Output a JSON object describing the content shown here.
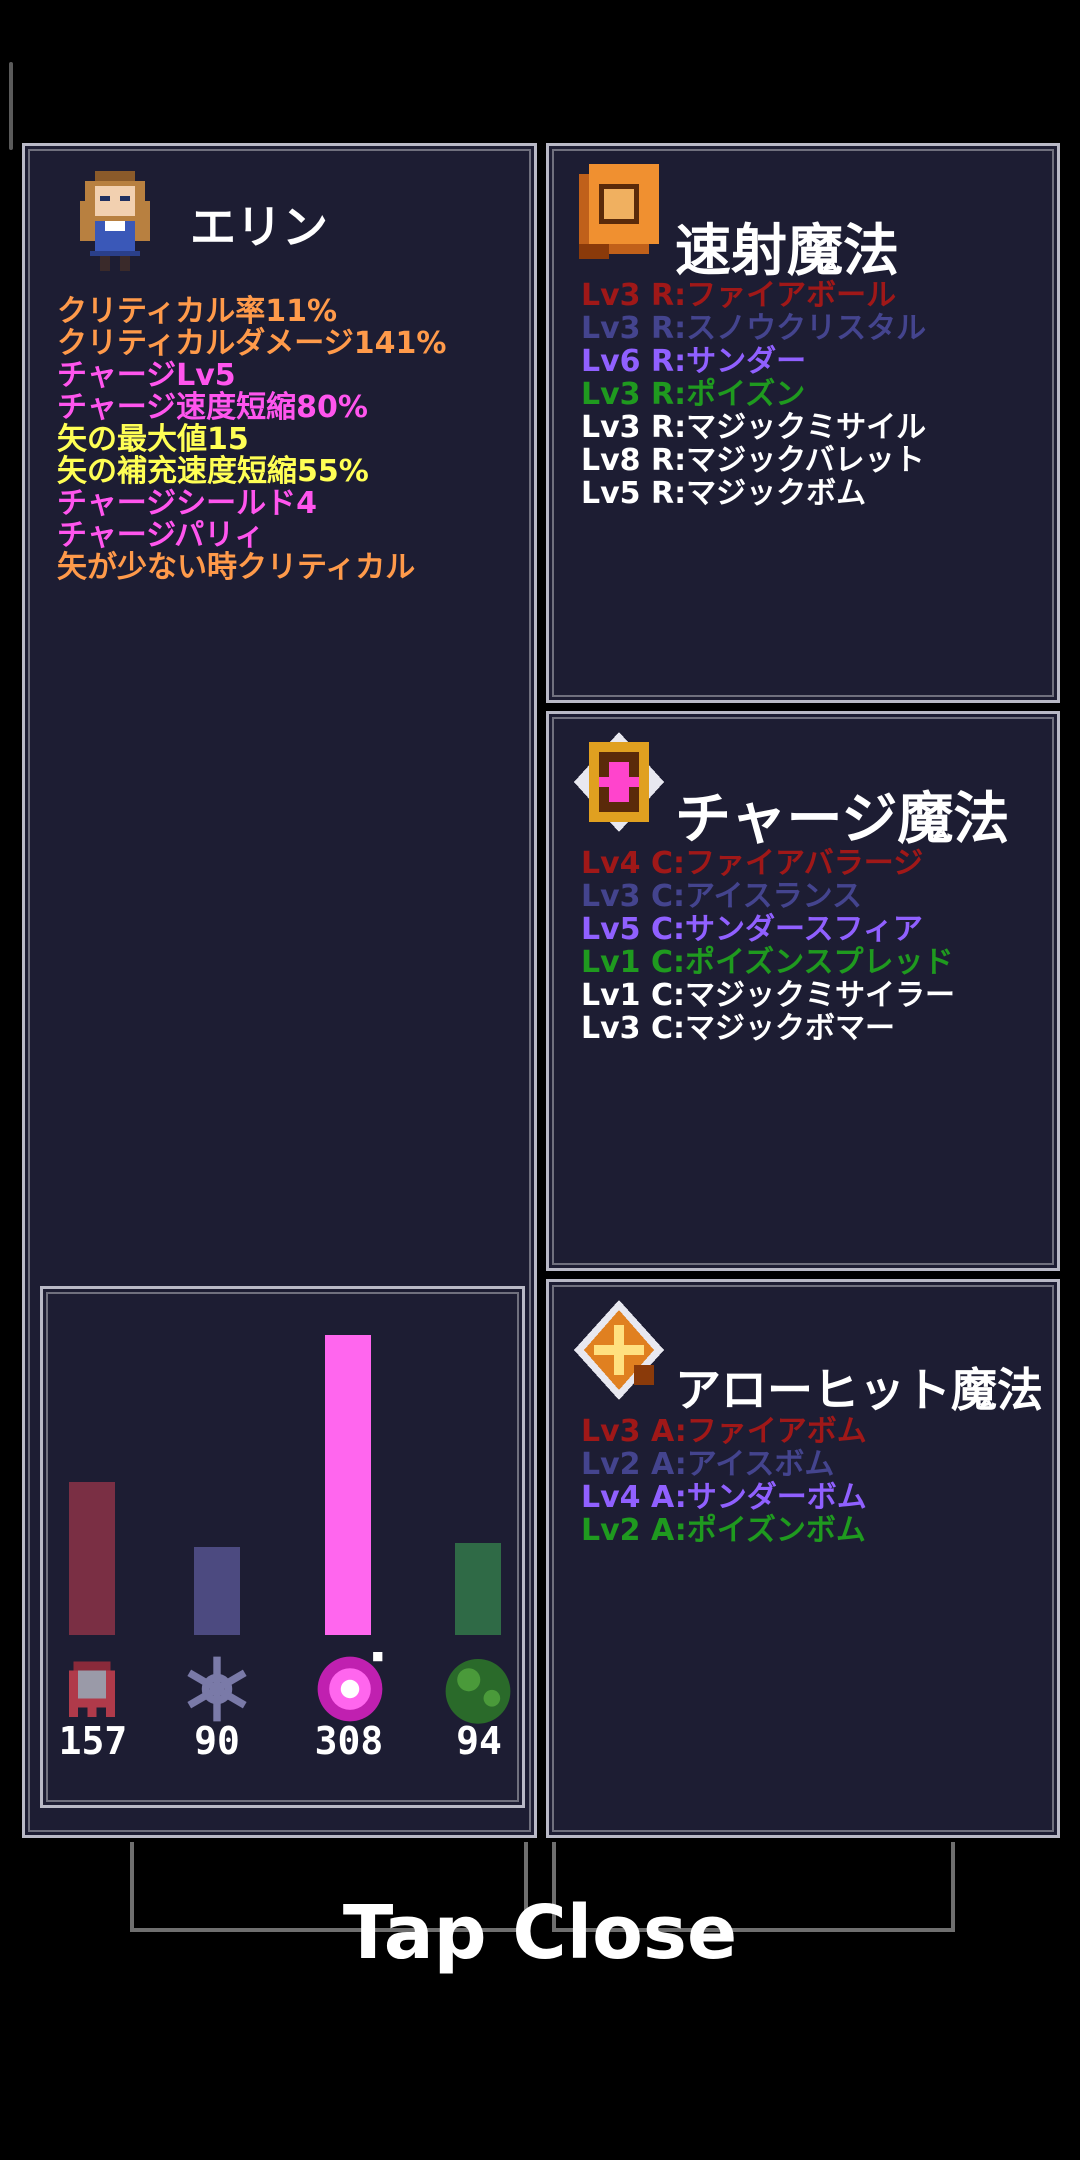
{
  "character": {
    "name": "エリン",
    "stats": [
      {
        "text": "クリティカル率11%",
        "color": "#ff9a4a"
      },
      {
        "text": "クリティカルダメージ141%",
        "color": "#ff9a4a"
      },
      {
        "text": "チャージLv5",
        "color": "#ff55ee"
      },
      {
        "text": "チャージ速度短縮80%",
        "color": "#ff55ee"
      },
      {
        "text": "矢の最大値15",
        "color": "#ffff55"
      },
      {
        "text": "矢の補充速度短縮55%",
        "color": "#ffff55"
      },
      {
        "text": "チャージシールド4",
        "color": "#ff55ee"
      },
      {
        "text": "チャージパリィ",
        "color": "#ff55ee"
      },
      {
        "text": "矢が少ない時クリティカル",
        "color": "#ff9a4a"
      }
    ]
  },
  "elements": [
    {
      "icon": "fire-ghost-icon",
      "value": "157",
      "level": 157,
      "bar_color": "#7a2f44"
    },
    {
      "icon": "ice-snowflake-icon",
      "value": "90",
      "level": 90,
      "bar_color": "#4c4a80"
    },
    {
      "icon": "thunder-orb-icon",
      "value": "308",
      "level": 308,
      "bar_color": "#ff66ee"
    },
    {
      "icon": "poison-blob-icon",
      "value": "94",
      "level": 94,
      "bar_color": "#2f6a46"
    }
  ],
  "rapid_magic": {
    "title": "速射魔法",
    "items": [
      {
        "text": "Lv3 R:ファイアボール",
        "color": "#a01818"
      },
      {
        "text": "Lv3 R:スノウクリスタル",
        "color": "#44448e"
      },
      {
        "text": "Lv6 R:サンダー",
        "color": "#9060ff"
      },
      {
        "text": "Lv3 R:ポイズン",
        "color": "#1f9a1f"
      },
      {
        "text": "Lv3 R:マジックミサイル",
        "color": "#ffffff"
      },
      {
        "text": "Lv8 R:マジックバレット",
        "color": "#ffffff"
      },
      {
        "text": "Lv5 R:マジックボム",
        "color": "#ffffff"
      }
    ]
  },
  "charge_magic": {
    "title": "チャージ魔法",
    "items": [
      {
        "text": "Lv4 C:ファイアバラージ",
        "color": "#a01818"
      },
      {
        "text": "Lv3 C:アイスランス",
        "color": "#44448e"
      },
      {
        "text": "Lv5 C:サンダースフィア",
        "color": "#9060ff"
      },
      {
        "text": "Lv1 C:ポイズンスプレッド",
        "color": "#1f9a1f"
      },
      {
        "text": "Lv1 C:マジックミサイラー",
        "color": "#ffffff"
      },
      {
        "text": "Lv3 C:マジックボマー",
        "color": "#ffffff"
      }
    ]
  },
  "arrowhit_magic": {
    "title": "アローヒット魔法",
    "items": [
      {
        "text": "Lv3 A:ファイアボム",
        "color": "#a01818"
      },
      {
        "text": "Lv2 A:アイスボム",
        "color": "#44448e"
      },
      {
        "text": "Lv4 A:サンダーボム",
        "color": "#9060ff"
      },
      {
        "text": "Lv2 A:ポイズンボム",
        "color": "#1f9a1f"
      }
    ]
  },
  "footer": {
    "close_label": "Tap Close"
  }
}
